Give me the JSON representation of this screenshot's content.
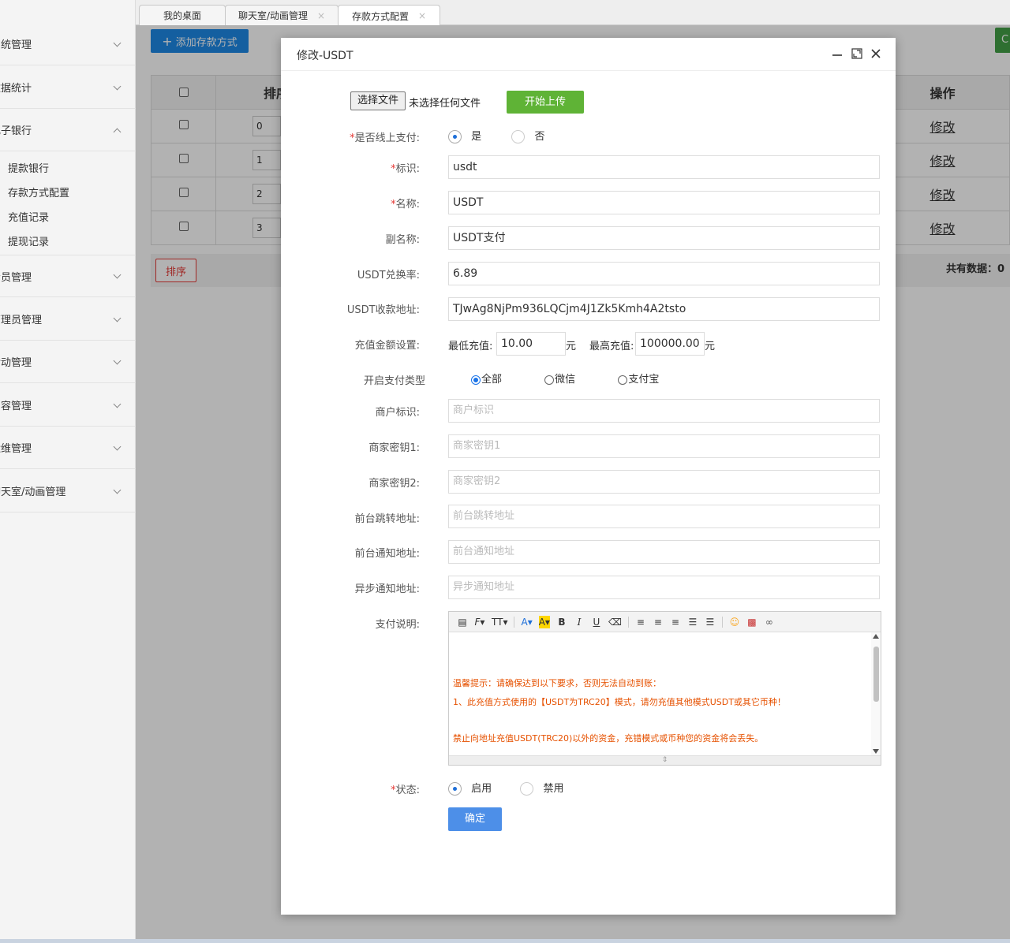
{
  "sidebar": {
    "items": [
      {
        "label": "系统管理",
        "expanded": false
      },
      {
        "label": "数据统计",
        "expanded": false
      },
      {
        "label": "电子银行",
        "expanded": true
      },
      {
        "label": "会员管理",
        "expanded": false
      },
      {
        "label": "管理员管理",
        "expanded": false
      },
      {
        "label": "活动管理",
        "expanded": false
      },
      {
        "label": "内容管理",
        "expanded": false
      },
      {
        "label": "运维管理",
        "expanded": false
      },
      {
        "label": "聊天室/动画管理",
        "expanded": false
      }
    ],
    "sub_items": [
      "提款银行",
      "存款方式配置",
      "充值记录",
      "提现记录"
    ]
  },
  "tabs": [
    {
      "label": "我的桌面"
    },
    {
      "label": "聊天室/动画管理",
      "close": "×"
    },
    {
      "label": "存款方式配置",
      "close": "×"
    }
  ],
  "background": {
    "add_button": "添加存款方式",
    "green_button": "C",
    "table": {
      "header_sort": "排序",
      "header_action": "操作",
      "rows": [
        {
          "sort": "0",
          "action": "修改"
        },
        {
          "sort": "1",
          "action": "修改"
        },
        {
          "sort": "2",
          "action": "修改"
        },
        {
          "sort": "3",
          "action": "修改"
        }
      ]
    },
    "sort_button": "排序",
    "total_text": "共有数据：0"
  },
  "modal": {
    "title": "修改-USDT",
    "file_button": "选择文件",
    "file_status": "未选择任何文件",
    "upload_button": "开始上传",
    "online_pay": {
      "label": "是否线上支付:",
      "yes": "是",
      "no": "否",
      "selected": "是"
    },
    "fields": {
      "identifier": {
        "label": "标识:",
        "value": "usdt"
      },
      "name": {
        "label": "名称:",
        "value": "USDT"
      },
      "subname": {
        "label": "副名称:",
        "value": "USDT支付"
      },
      "rate": {
        "label": "USDT兑换率:",
        "value": "6.89"
      },
      "address": {
        "label": "USDT收款地址:",
        "value": "TJwAg8NjPm936LQCjm4J1Zk5Kmh4A2tsto"
      },
      "merchant_id": {
        "label": "商户标识:",
        "placeholder": "商户标识"
      },
      "key1": {
        "label": "商家密钥1:",
        "placeholder": "商家密钥1"
      },
      "key2": {
        "label": "商家密钥2:",
        "placeholder": "商家密钥2"
      },
      "front_redirect": {
        "label": "前台跳转地址:",
        "placeholder": "前台跳转地址"
      },
      "front_notify": {
        "label": "前台通知地址:",
        "placeholder": "前台通知地址"
      },
      "async_notify": {
        "label": "异步通知地址:",
        "placeholder": "异步通知地址"
      }
    },
    "amount": {
      "label": "充值金额设置:",
      "min_label": "最低充值:",
      "min_value": "10.00",
      "max_label": "最高充值:",
      "max_value": "100000.00",
      "unit": "元"
    },
    "pay_type": {
      "label": "开启支付类型",
      "options": [
        "全部",
        "微信",
        "支付宝"
      ],
      "selected": "全部"
    },
    "description": {
      "label": "支付说明:",
      "lines": [
        "温馨提示：请确保达到以下要求，否则无法自动到账：",
        "1、此充值方式使用的【USDT为TRC20】模式，请勿充值其他模式USDT或其它币种！",
        "禁止向地址充值USDT(TRC20)以外的资金，充错模式或币种您的资金将会丢失。"
      ]
    },
    "status": {
      "label": "状态:",
      "enabled": "启用",
      "disabled": "禁用",
      "selected": "启用"
    },
    "confirm_button": "确定"
  },
  "colors": {
    "primary": "#1e88e5",
    "upload": "#5fb336",
    "confirm": "#4d8fe8",
    "required": "#e53935",
    "notice": "#e65100"
  }
}
